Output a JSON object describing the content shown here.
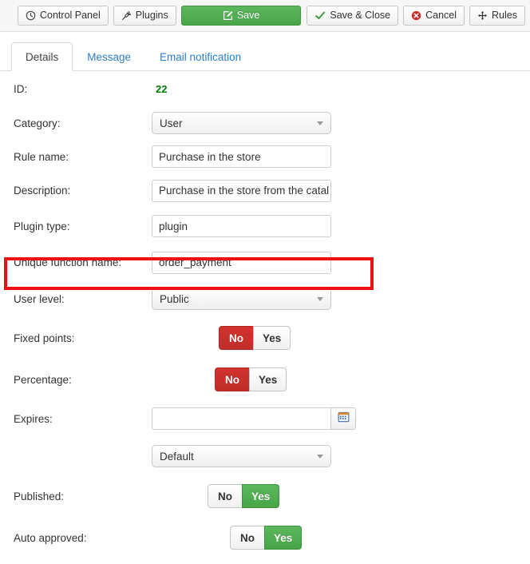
{
  "toolbar": {
    "buttons": [
      {
        "label": "Control Panel",
        "icon": "clock-icon",
        "style": "default"
      },
      {
        "label": "Plugins",
        "icon": "plug-icon",
        "style": "default"
      },
      {
        "label": "Save",
        "icon": "edit-pencil-icon",
        "style": "primary"
      },
      {
        "label": "Save & Close",
        "icon": "check-icon",
        "style": "default"
      },
      {
        "label": "Cancel",
        "icon": "cancel-circle-icon",
        "style": "default"
      },
      {
        "label": "Rules",
        "icon": "move-arrows-icon",
        "style": "default"
      }
    ]
  },
  "tabs": [
    {
      "label": "Details",
      "active": true
    },
    {
      "label": "Message",
      "active": false
    },
    {
      "label": "Email notification",
      "active": false
    }
  ],
  "form": {
    "id": {
      "label": "ID:",
      "value": "22"
    },
    "category": {
      "label": "Category:",
      "value": "User"
    },
    "rule_name": {
      "label": "Rule name:",
      "value": "Purchase in the store"
    },
    "description": {
      "label": "Description:",
      "value": "Purchase in the store from the catal"
    },
    "plugin_type": {
      "label": "Plugin type:",
      "value": "plugin"
    },
    "unique_function_name": {
      "label": "Unique function name:",
      "value": "order_payment"
    },
    "user_level": {
      "label": "User level:",
      "value": "Public"
    },
    "fixed_points": {
      "label": "Fixed points:",
      "no": "No",
      "yes": "Yes",
      "selected": "No"
    },
    "percentage": {
      "label": "Percentage:",
      "no": "No",
      "yes": "Yes",
      "selected": "No"
    },
    "expires": {
      "label": "Expires:",
      "value": "",
      "calendar_icon": "calendar-icon"
    },
    "expires_mode": {
      "value": "Default"
    },
    "published": {
      "label": "Published:",
      "no": "No",
      "yes": "Yes",
      "selected": "Yes"
    },
    "auto_approved": {
      "label": "Auto approved:",
      "no": "No",
      "yes": "Yes",
      "selected": "Yes"
    }
  },
  "colors": {
    "primary_green": "#5cb85c",
    "danger_red": "#c12e2a",
    "link_blue": "#2a7fc9",
    "id_green": "#008000",
    "highlight_red": "#ee1111"
  }
}
